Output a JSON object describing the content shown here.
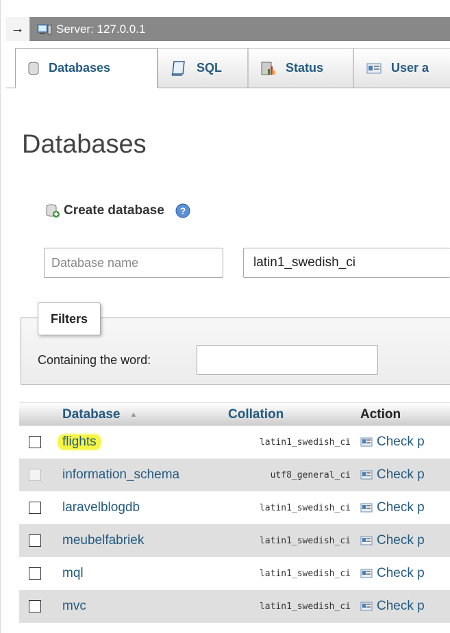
{
  "server": {
    "label": "Server: 127.0.0.1",
    "arrow": "→"
  },
  "tabs": [
    {
      "label": "Databases",
      "icon": "database-icon",
      "active": true
    },
    {
      "label": "SQL",
      "icon": "sql-icon"
    },
    {
      "label": "Status",
      "icon": "status-chart-icon"
    },
    {
      "label": "User a",
      "icon": "user-accounts-icon"
    }
  ],
  "page": {
    "title": "Databases"
  },
  "create": {
    "label": "Create database",
    "name_placeholder": "Database name",
    "collation": "latin1_swedish_ci"
  },
  "filters": {
    "legend": "Filters",
    "containing_label": "Containing the word:",
    "value": ""
  },
  "table": {
    "headers": {
      "database": "Database",
      "sort": "▲",
      "collation": "Collation",
      "action": "Action"
    },
    "rows": [
      {
        "name": "flights",
        "collation": "latin1_swedish_ci",
        "action": "Check p",
        "highlighted": true,
        "checkbox_enabled": true
      },
      {
        "name": "information_schema",
        "collation": "utf8_general_ci",
        "action": "Check p",
        "checkbox_enabled": false
      },
      {
        "name": "laravelblogdb",
        "collation": "latin1_swedish_ci",
        "action": "Check p",
        "checkbox_enabled": true
      },
      {
        "name": "meubelfabriek",
        "collation": "latin1_swedish_ci",
        "action": "Check p",
        "checkbox_enabled": true
      },
      {
        "name": "mql",
        "collation": "latin1_swedish_ci",
        "action": "Check p",
        "checkbox_enabled": true
      },
      {
        "name": "mvc",
        "collation": "latin1_swedish_ci",
        "action": "Check p",
        "checkbox_enabled": true
      }
    ]
  },
  "colors": {
    "link": "#235a81",
    "highlight": "#f5f542",
    "serverbar": "#888888",
    "row_alt": "#dfdfdf"
  }
}
